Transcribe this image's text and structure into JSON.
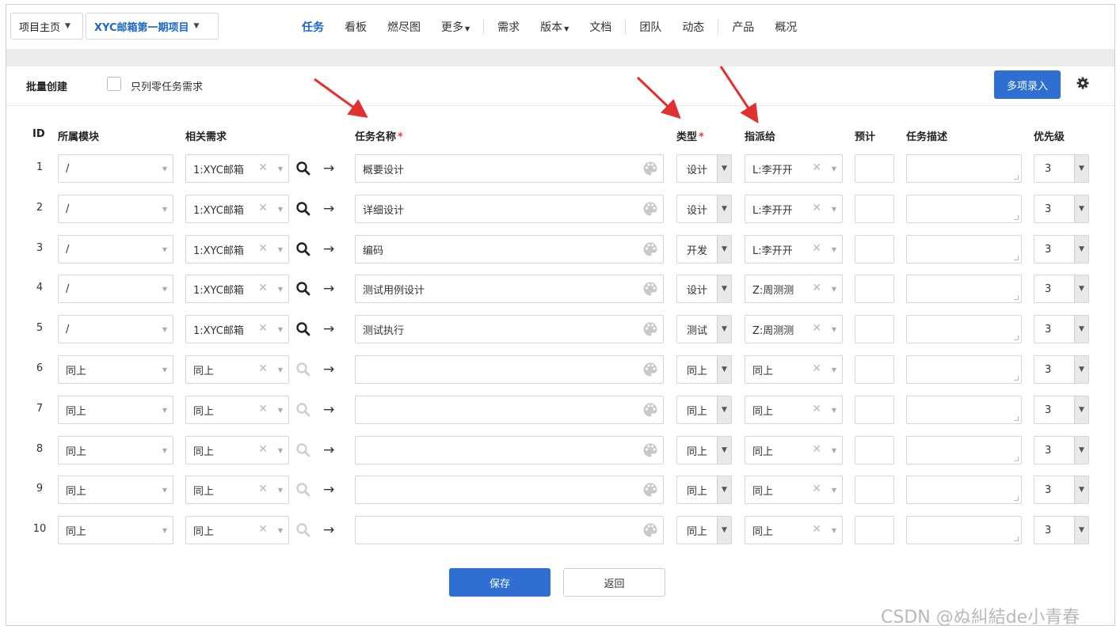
{
  "breadcrumb": {
    "home": "项目主页",
    "project": "XYC邮箱第一期项目"
  },
  "nav": [
    {
      "label": "任务",
      "active": true,
      "caret": false
    },
    {
      "label": "看板",
      "active": false,
      "caret": false
    },
    {
      "label": "燃尽图",
      "active": false,
      "caret": false
    },
    {
      "label": "更多",
      "active": false,
      "caret": true
    },
    {
      "sep": true
    },
    {
      "label": "需求",
      "active": false,
      "caret": false
    },
    {
      "label": "版本",
      "active": false,
      "caret": true
    },
    {
      "label": "文档",
      "active": false,
      "caret": false
    },
    {
      "sep": true
    },
    {
      "label": "团队",
      "active": false,
      "caret": false
    },
    {
      "label": "动态",
      "active": false,
      "caret": false
    },
    {
      "sep": true
    },
    {
      "label": "产品",
      "active": false,
      "caret": false
    },
    {
      "label": "概况",
      "active": false,
      "caret": false
    }
  ],
  "panel": {
    "title": "批量创建",
    "only_zero_task_label": "只列零任务需求",
    "multi_input_label": "多项录入"
  },
  "columns": {
    "id": "ID",
    "module": "所属模块",
    "story": "相关需求",
    "name": "任务名称",
    "type": "类型",
    "assign": "指派给",
    "estimate": "预计",
    "desc": "任务描述",
    "priority": "优先级",
    "required_mark": "*"
  },
  "rows": [
    {
      "id": "1",
      "module": "/",
      "story": "1:XYC邮箱",
      "name": "概要设计",
      "type": "设计",
      "assign": "L:李开开",
      "priority": "3",
      "search_active": true
    },
    {
      "id": "2",
      "module": "/",
      "story": "1:XYC邮箱",
      "name": "详细设计",
      "type": "设计",
      "assign": "L:李开开",
      "priority": "3",
      "search_active": true
    },
    {
      "id": "3",
      "module": "/",
      "story": "1:XYC邮箱",
      "name": "编码",
      "type": "开发",
      "assign": "L:李开开",
      "priority": "3",
      "search_active": true
    },
    {
      "id": "4",
      "module": "/",
      "story": "1:XYC邮箱",
      "name": "测试用例设计",
      "type": "设计",
      "assign": "Z:周测测",
      "priority": "3",
      "search_active": true
    },
    {
      "id": "5",
      "module": "/",
      "story": "1:XYC邮箱",
      "name": "测试执行",
      "type": "测试",
      "assign": "Z:周测测",
      "priority": "3",
      "search_active": true
    },
    {
      "id": "6",
      "module": "同上",
      "story": "同上",
      "name": "",
      "type": "同上",
      "assign": "同上",
      "priority": "3",
      "search_active": false
    },
    {
      "id": "7",
      "module": "同上",
      "story": "同上",
      "name": "",
      "type": "同上",
      "assign": "同上",
      "priority": "3",
      "search_active": false
    },
    {
      "id": "8",
      "module": "同上",
      "story": "同上",
      "name": "",
      "type": "同上",
      "assign": "同上",
      "priority": "3",
      "search_active": false
    },
    {
      "id": "9",
      "module": "同上",
      "story": "同上",
      "name": "",
      "type": "同上",
      "assign": "同上",
      "priority": "3",
      "search_active": false
    },
    {
      "id": "10",
      "module": "同上",
      "story": "同上",
      "name": "",
      "type": "同上",
      "assign": "同上",
      "priority": "3",
      "search_active": false
    }
  ],
  "actions": {
    "save": "保存",
    "back": "返回"
  },
  "watermark": "CSDN @ぬ糾結de小青春",
  "colors": {
    "primary": "#2e6fd1",
    "annotation": "#e03030",
    "required": "#e04040"
  }
}
